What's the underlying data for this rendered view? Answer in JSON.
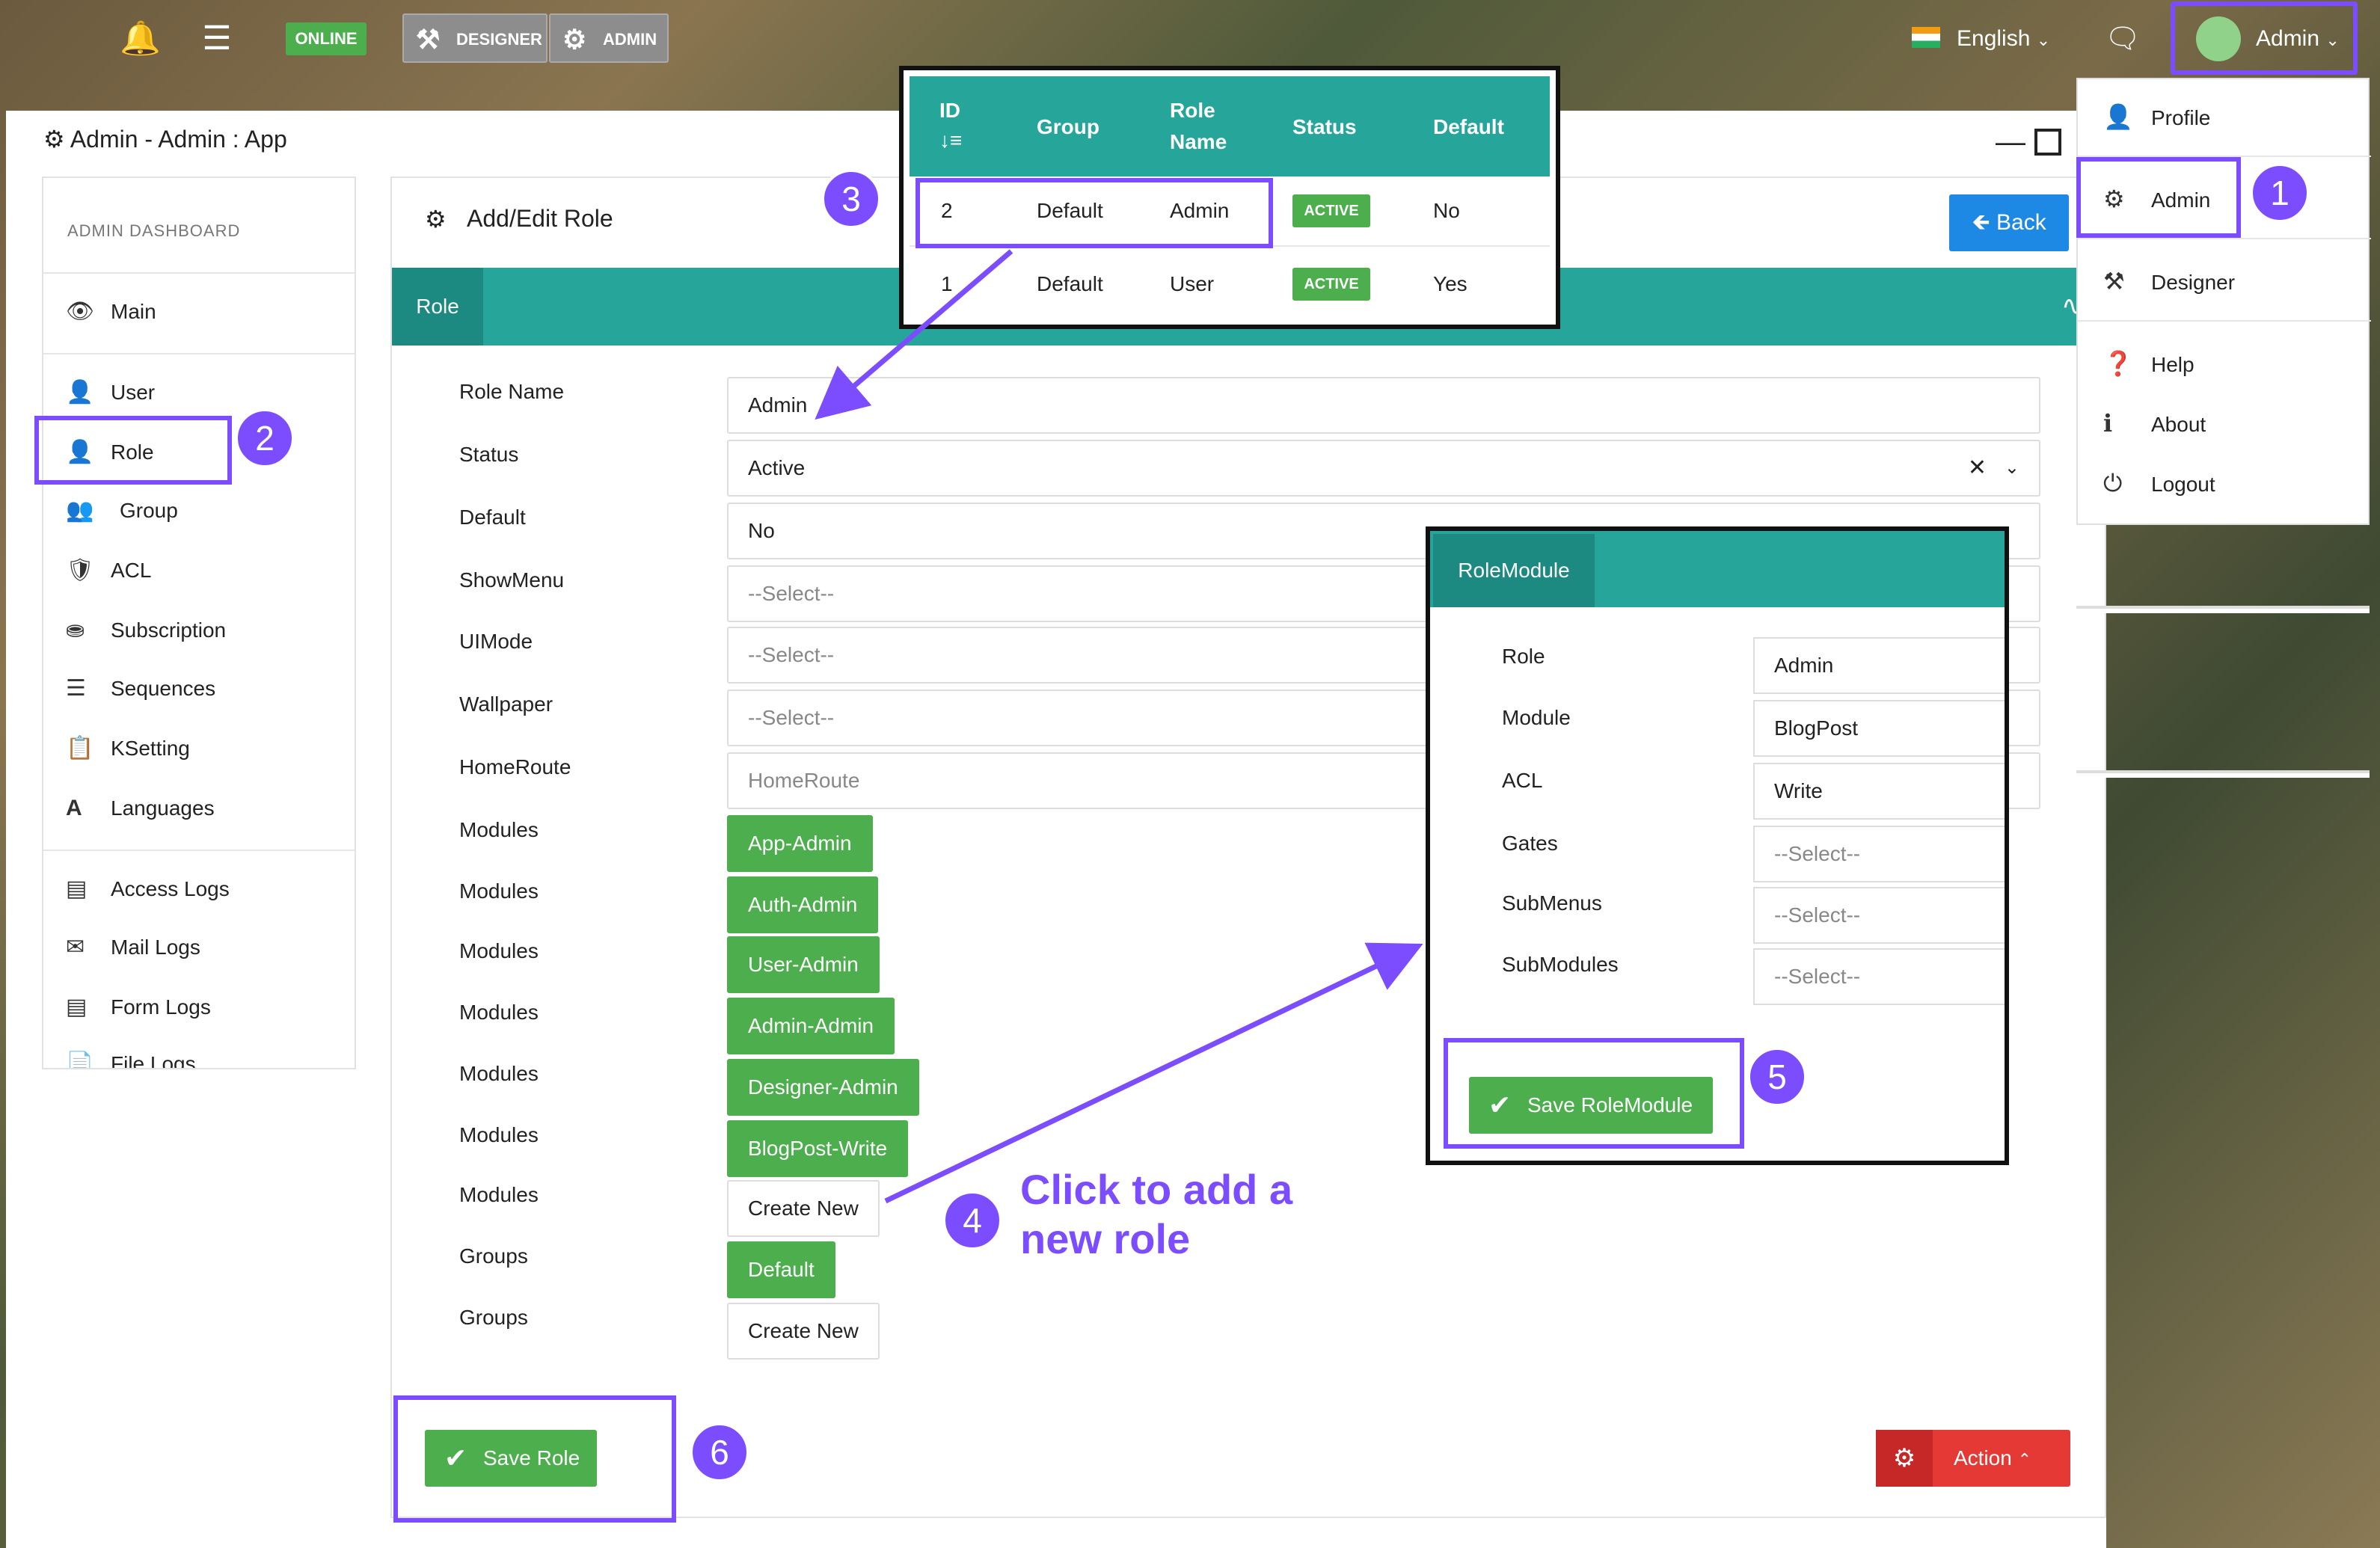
{
  "topbar": {
    "online": "ONLINE",
    "designer": "DESIGNER",
    "admin": "ADMIN",
    "language": "English",
    "user": "Admin"
  },
  "window": {
    "title": "Admin - Admin : App"
  },
  "sidebar": {
    "heading": "ADMIN DASHBOARD",
    "items": [
      {
        "label": "Main"
      },
      {
        "label": "User"
      },
      {
        "label": "Role"
      },
      {
        "label": "Group"
      },
      {
        "label": "ACL"
      },
      {
        "label": "Subscription"
      },
      {
        "label": "Sequences"
      },
      {
        "label": "KSetting"
      },
      {
        "label": "Languages"
      },
      {
        "label": "Access Logs"
      },
      {
        "label": "Mail Logs"
      },
      {
        "label": "Form Logs"
      },
      {
        "label": "File Logs"
      }
    ]
  },
  "panel": {
    "title": "Add/Edit Role",
    "back": "Back",
    "tab": "Role"
  },
  "form": {
    "role_name": {
      "label": "Role Name",
      "value": "Admin"
    },
    "status": {
      "label": "Status",
      "value": "Active"
    },
    "default": {
      "label": "Default",
      "value": "No"
    },
    "showmenu": {
      "label": "ShowMenu",
      "placeholder": "--Select--"
    },
    "uimode": {
      "label": "UIMode",
      "placeholder": "--Select--"
    },
    "wallpaper": {
      "label": "Wallpaper",
      "placeholder": "--Select--"
    },
    "homeroute": {
      "label": "HomeRoute",
      "placeholder": "HomeRoute"
    },
    "modules_label": "Modules",
    "modules": [
      "App-Admin",
      "Auth-Admin",
      "User-Admin",
      "Admin-Admin",
      "Designer-Admin",
      "BlogPost-Write"
    ],
    "create_new": "Create New",
    "groups_label": "Groups",
    "groups": [
      "Default"
    ]
  },
  "actions": {
    "save_role": "Save Role",
    "action": "Action"
  },
  "dropdown": {
    "items": [
      {
        "label": "Profile"
      },
      {
        "label": "Admin"
      },
      {
        "label": "Designer"
      },
      {
        "label": "Help"
      },
      {
        "label": "About"
      },
      {
        "label": "Logout"
      }
    ]
  },
  "role_table": {
    "headers": [
      "ID",
      "Group",
      "Role",
      "Name",
      "Status",
      "Default"
    ],
    "rows": [
      {
        "id": "2",
        "group": "Default",
        "role": "Admin",
        "status": "ACTIVE",
        "default": "No"
      },
      {
        "id": "1",
        "group": "Default",
        "role": "User",
        "status": "ACTIVE",
        "default": "Yes"
      }
    ]
  },
  "role_module": {
    "tab": "RoleModule",
    "fields": [
      {
        "label": "Role",
        "value": "Admin"
      },
      {
        "label": "Module",
        "value": "BlogPost"
      },
      {
        "label": "ACL",
        "value": "Write"
      },
      {
        "label": "Gates",
        "value": "--Select--"
      },
      {
        "label": "SubMenus",
        "value": "--Select--"
      },
      {
        "label": "SubModules",
        "value": "--Select--"
      }
    ],
    "save": "Save RoleModule"
  },
  "callouts": [
    "1",
    "2",
    "3",
    "4",
    "5",
    "6"
  ],
  "annotation": "Click to add a new role",
  "accent_color": "#7c4dff",
  "teal_color": "#26a69a"
}
